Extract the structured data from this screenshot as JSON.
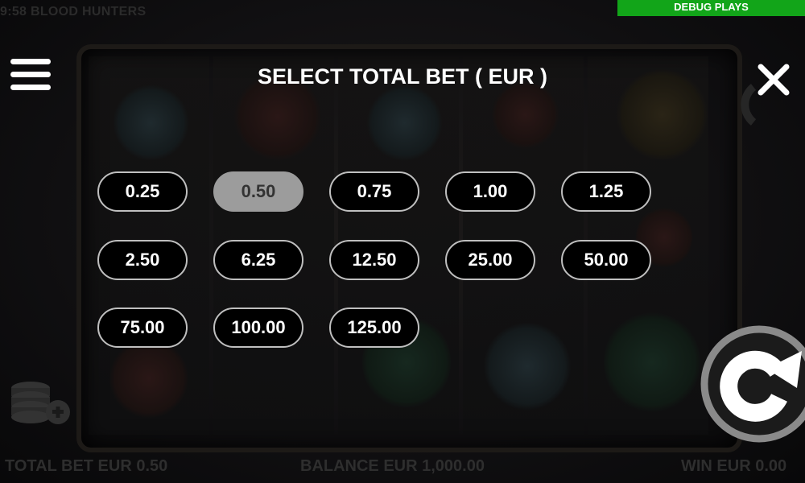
{
  "header": {
    "time_title": "9:58  BLOOD HUNTERS",
    "debug_label": "DEBUG PLAYS"
  },
  "dialog": {
    "title": "SELECT TOTAL BET ( EUR )",
    "options": [
      "0.25",
      "0.50",
      "0.75",
      "1.00",
      "1.25",
      "2.50",
      "6.25",
      "12.50",
      "25.00",
      "50.00",
      "75.00",
      "100.00",
      "125.00"
    ],
    "selected": "0.50"
  },
  "footer": {
    "total_bet": "TOTAL BET EUR 0.50",
    "balance": "BALANCE EUR 1,000.00",
    "win": "WIN EUR 0.00"
  },
  "icons": {
    "menu": "hamburger-icon",
    "close": "close-icon",
    "coins": "coins-plus-icon",
    "spin": "spin-icon"
  },
  "colors": {
    "debug_green": "#12a519",
    "selected_bet": "#9c9c9c",
    "button_border": "#bfbfbf"
  }
}
